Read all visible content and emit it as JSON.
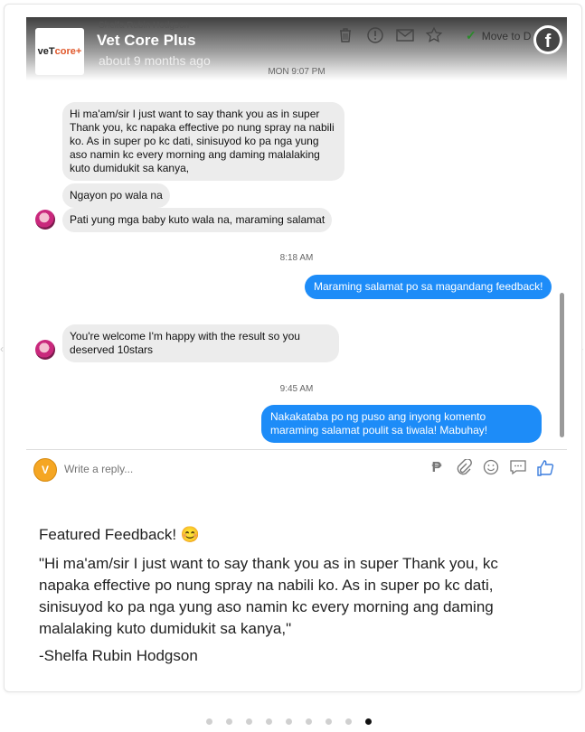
{
  "header": {
    "sender_small": "Shelfa Rubin Hodgson",
    "page_name": "Vet Core Plus",
    "time_ago": "about 9 months ago",
    "logo_text_a": "veT",
    "logo_text_b": "core+",
    "move_to": "Move to D",
    "fb_letter": "f"
  },
  "icons": [
    "trash-icon",
    "report-icon",
    "mail-icon",
    "star-icon",
    "check-icon",
    "facebook-icon"
  ],
  "conversation": {
    "ts1": "MON 9:07 PM",
    "msg1": "Hi ma'am/sir I just want to say thank you as in super Thank you, kc napaka effective po nung spray na nabili ko. As in super po kc dati, sinisuyod ko pa nga yung aso namin kc every morning ang daming malalaking kuto dumidukit sa kanya,",
    "msg2": "Ngayon po wala na",
    "msg3": "Pati yung mga baby kuto wala na, maraming salamat",
    "ts2": "8:18 AM",
    "reply1": "Maraming salamat po sa magandang feedback!",
    "msg4": "You're welcome I'm happy with the result so you deserved 10stars",
    "ts3": "9:45 AM",
    "reply2": "Nakakataba po ng puso ang inyong komento maraming salamat poulit sa tiwala! Mabuhay!"
  },
  "reply_bar": {
    "placeholder": "Write a reply...",
    "avatar_letter": "V",
    "peso": "₱"
  },
  "feedback": {
    "heading": "Featured Feedback! 😊",
    "quote": "\"Hi ma'am/sir I just want to say thank you as in super Thank you, kc napaka effective po nung spray na nabili ko. As in super po kc dati, sinisuyod ko pa nga yung aso namin kc every morning ang daming malalaking kuto dumidukit sa kanya,\"",
    "author": "-Shelfa Rubin Hodgson"
  },
  "carousel": {
    "total": 9,
    "active_index": 8
  }
}
